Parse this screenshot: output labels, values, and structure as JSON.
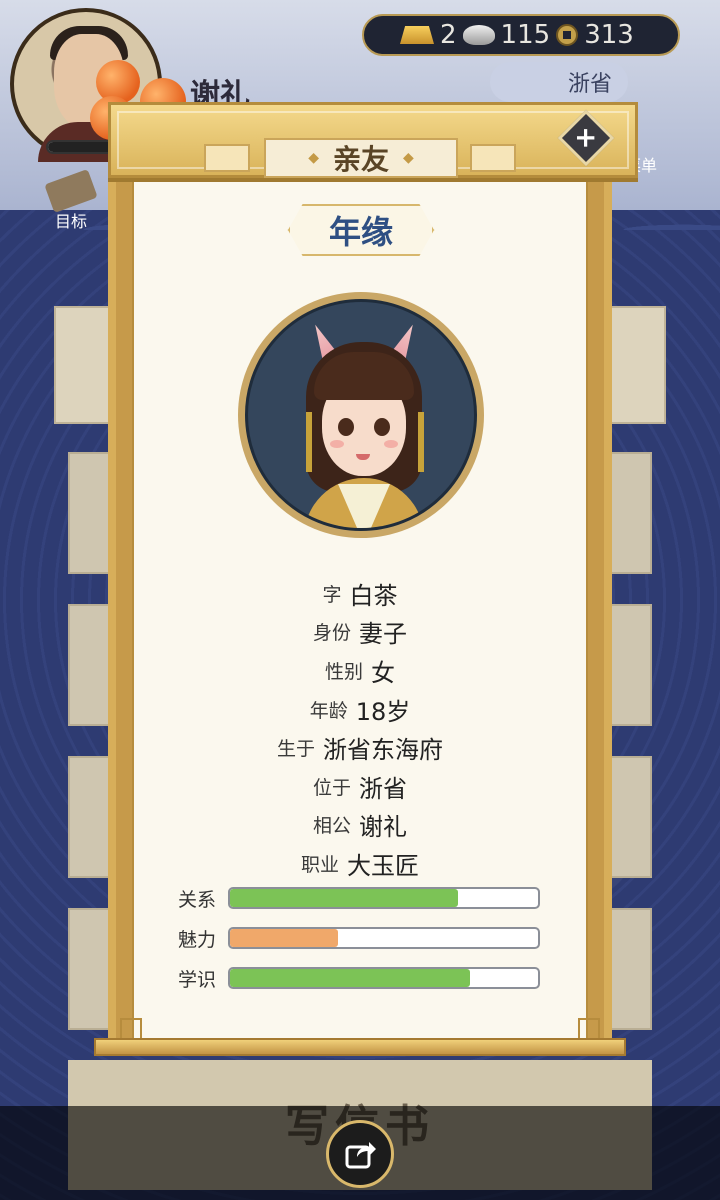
{
  "player": {
    "name": "谢礼",
    "location": "浙省"
  },
  "currency": {
    "gold": "2",
    "silver": "115",
    "coins": "313"
  },
  "buttons": {
    "target": "目标",
    "menu": "菜单"
  },
  "modal": {
    "header": "亲友",
    "tag": "年缘",
    "fields": [
      {
        "label": "字",
        "value": "白茶"
      },
      {
        "label": "身份",
        "value": "妻子"
      },
      {
        "label": "性别",
        "value": "女"
      },
      {
        "label": "年龄",
        "value": "18岁"
      },
      {
        "label": "生于",
        "value": "浙省东海府"
      },
      {
        "label": "位于",
        "value": "浙省"
      },
      {
        "label": "相公",
        "value": "谢礼"
      },
      {
        "label": "职业",
        "value": "大玉匠"
      }
    ],
    "stats": [
      {
        "label": "关系",
        "fraction": 0.74,
        "color": "#7cc356"
      },
      {
        "label": "魅力",
        "fraction": 0.35,
        "color": "#f0a86a"
      },
      {
        "label": "学识",
        "fraction": 0.78,
        "color": "#7cc356"
      }
    ]
  },
  "background": {
    "write_letter": "写信书"
  }
}
